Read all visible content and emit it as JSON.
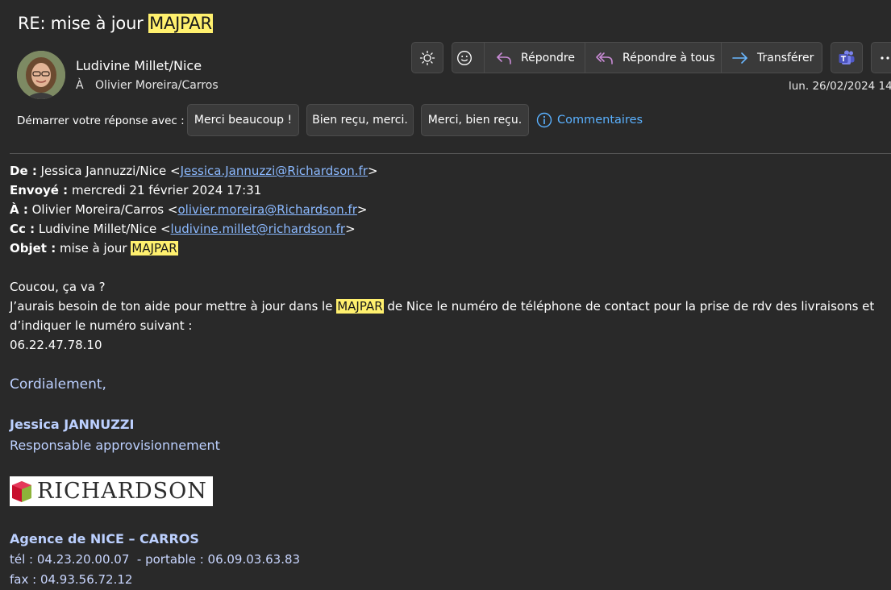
{
  "header": {
    "subject_prefix": "RE: mise à jour ",
    "subject_highlight": "MAJPAR",
    "sender": "Ludivine Millet/Nice",
    "to_label": "À",
    "to_value": "Olivier Moreira/Carros",
    "date": "lun. 26/02/2024 14:"
  },
  "actions": {
    "reply": "Répondre",
    "reply_all": "Répondre à tous",
    "forward": "Transférer"
  },
  "quick_replies": {
    "label": "Démarrer votre réponse avec :",
    "items": [
      "Merci beaucoup !",
      "Bien reçu, merci.",
      "Merci, bien reçu."
    ],
    "comments": "Commentaires"
  },
  "message": {
    "from_label": "De :",
    "from_name": " Jessica Jannuzzi/Nice <",
    "from_email": "Jessica.Jannuzzi@Richardson.fr",
    "from_close": ">",
    "sent_label": "Envoyé :",
    "sent_value": " mercredi 21 février 2024 17:31",
    "to_label": "À :",
    "to_name": " Olivier Moreira/Carros <",
    "to_email": "olivier.moreira@Richardson.fr",
    "to_close": ">",
    "cc_label": "Cc :",
    "cc_name": " Ludivine Millet/Nice <",
    "cc_email": "ludivine.millet@richardson.fr",
    "cc_close": ">",
    "subject_label": "Objet :",
    "subject_text": " mise à jour ",
    "subject_highlight": "MAJPAR",
    "greeting": "Coucou, ça va ?",
    "body_part1": "J’aurais besoin de ton aide pour mettre à jour dans le ",
    "body_highlight": "MAJPAR",
    "body_part2": " de Nice le numéro de téléphone de contact pour la prise de rdv des livraisons et d’indiquer le numéro suivant :",
    "phone": "06.22.47.78.10",
    "closing": "Cordialement,",
    "sig_name": "Jessica JANNUZZI",
    "sig_role": "Responsable approvisionnement",
    "logo_text": "RICHARDSON",
    "agency": "Agence de NICE – CARROS",
    "tel_line": "tél : 04.23.20.00.07  - portable : 06.09.03.63.83",
    "fax_line": "fax : 04.93.56.72.12"
  },
  "colors": {
    "background": "#292929",
    "highlight": "#fff06e",
    "link": "#8bb9ff",
    "accent_blue": "#5ab1ff",
    "reply_icon": "#c98bd6",
    "forward_icon": "#6ab7ff"
  },
  "icons": [
    "sun-icon",
    "emoji-icon",
    "reply-icon",
    "reply-all-icon",
    "forward-icon",
    "teams-icon",
    "more-icon",
    "info-icon"
  ]
}
